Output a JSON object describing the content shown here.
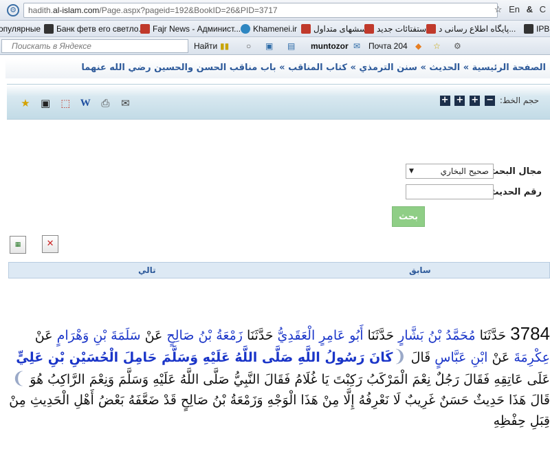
{
  "browser": {
    "url_rest": "hadith.",
    "url_host": "al-islam.com",
    "url_path": "/Page.aspx?pageid=192&BookID=26&PID=3717",
    "lang": "En",
    "amp": "&",
    "refresh": "C"
  },
  "bookmarks": [
    {
      "label": "опулярные",
      "color": "#ffffff"
    },
    {
      "label": "Банк фетв его светло...",
      "color": "#333333"
    },
    {
      "label": "Fajr News - Админист...",
      "color": "#c0392b"
    },
    {
      "label": "Khamenei.ir",
      "color": "#2e86c1"
    },
    {
      "label": "پرسشهای متداول",
      "color": "#c0392b"
    },
    {
      "label": "استفتائات جدید",
      "color": "#c0392b"
    },
    {
      "label": "پایگاه اطلاع رسانی د...",
      "color": "#c0392b"
    },
    {
      "label": "IPB",
      "color": "#333333"
    }
  ],
  "toolbar": {
    "yandex_placeholder": "Поискать в Яндексе",
    "find": "Найти",
    "user": "muntozor",
    "mail": "Почта 204"
  },
  "breadcrumb": "الصفحة الرئيسية » الحديث » سنن الترمذي » كتاب المناقب » باب مناقب الحسن والحسين رضي الله عنهما",
  "tools": {
    "font_size_label": "حجم الخط:"
  },
  "search": {
    "field_label": "مجال البحث:",
    "field_value": "صحيح البخاري",
    "number_label": "رقم الحديث:",
    "button": "بحث"
  },
  "pager": {
    "next": "تالي",
    "prev": "سابق"
  },
  "hadith": {
    "number": "3784",
    "p1": " حَدَّثَنَا ",
    "n1": "مُحَمَّدُ بْنُ بَشَّارٍ",
    "p2": " حَدَّثَنَا ",
    "n2": "أَبُو عَامِرٍ الْعَقَدِيُّ",
    "p3": " حَدَّثَنَا ",
    "n3": "زَمْعَةُ بْنُ صَالِحٍ",
    "p4": " عَنْ ",
    "n4": "سَلَمَةَ بْنِ وَهْرَامٍ",
    "p5": " عَنْ ",
    "n5": "عِكْرِمَةَ",
    "p6": " عَنْ ",
    "n6": "ابْنِ عَبَّاسٍ",
    "p7": " قَالَ ",
    "quote": "كَانَ رَسُولُ اللَّهِ صَلَّى اللَّهُ عَلَيْهِ وَسَلَّمَ حَامِلَ الْحُسَيْنِ بْنِ عَلِيٍّ",
    "p8": " عَلَى عَاتِقِهِ فَقَالَ رَجُلٌ نِعْمَ الْمَرْكَبُ رَكِبْتَ يَا غُلَامُ فَقَالَ النَّبِيُّ صَلَّى اللَّهُ عَلَيْهِ وَسَلَّمَ وَنِعْمَ الرَّاكِبُ هُوَ ",
    "p9": " قَالَ هَذَا حَدِيثٌ حَسَنٌ غَرِيبٌ لَا نَعْرِفُهُ إِلَّا مِنْ هَذَا الْوَجْهِ وَزَمْعَةُ بْنُ صَالِحٍ قَدْ ضَعَّفَهُ بَعْضُ أَهْلِ الْحَدِيثِ مِنْ قِبَلِ حِفْظِهِ"
  }
}
